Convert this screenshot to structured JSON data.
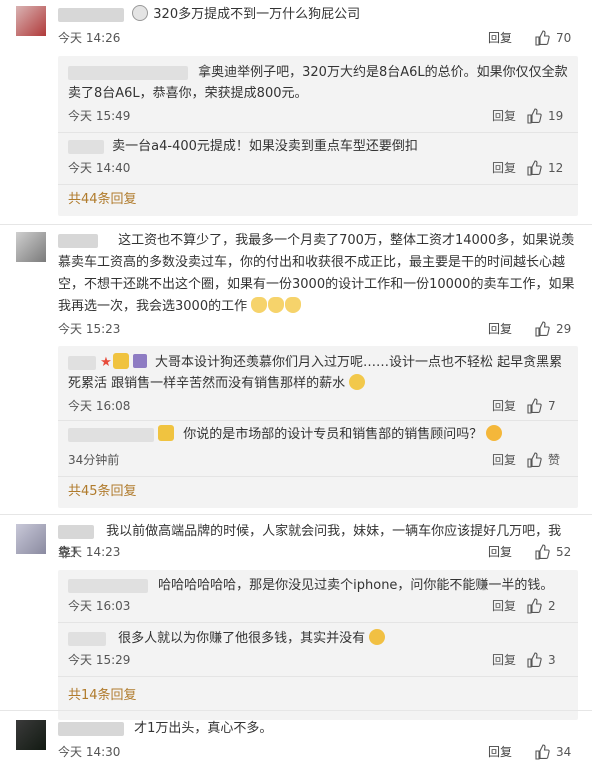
{
  "comments": [
    {
      "text": "320多万提成不到一万什么狗屁公司",
      "time": "今天 14:26",
      "reply_label": "回复",
      "likes": "70",
      "replies": [
        {
          "text": "拿奥迪举例子吧，320万大约是8台A6L的总价。如果你仅仅全款卖了8台A6L，恭喜你，荣获提成800元。",
          "time": "今天 15:49",
          "reply_label": "回复",
          "likes": "19"
        },
        {
          "text": "卖一台a4-400元提成！如果没卖到重点车型还要倒扣",
          "time": "今天 14:40",
          "reply_label": "回复",
          "likes": "12"
        }
      ],
      "more": "共44条回复"
    },
    {
      "text": "这工资也不算少了，我最多一个月卖了700万，整体工资才14000多，如果说羡慕卖车工资高的多数没卖过车，你的付出和收获很不成正比，最主要是干的时间越长心越空，不想干还跳不出这个圈，如果有一份3000的设计工作和一份10000的卖车工作，如果我再选一次，我会选3000的工作",
      "time": "今天 15:23",
      "reply_label": "回复",
      "likes": "29",
      "replies": [
        {
          "text": "大哥本设计狗还羡慕你们月入过万呢……设计一点也不轻松 起早贪黑累死累活 跟销售一样辛苦然而没有销售那样的薪水",
          "time": "今天 16:08",
          "reply_label": "回复",
          "likes": "7"
        },
        {
          "text": "你说的是市场部的设计专员和销售部的销售顾问吗？",
          "time": "34分钟前",
          "reply_label": "回复",
          "likes": "赞"
        }
      ],
      "more": "共45条回复"
    },
    {
      "text": "我以前做高端品牌的时候，人家就会问我，妹妹，一辆车你应该提好几万吧，我靠！",
      "time": "今天 14:23",
      "reply_label": "回复",
      "likes": "52",
      "replies": [
        {
          "text": "哈哈哈哈哈哈，那是你没见过卖个iphone，问你能不能赚一半的钱。",
          "time": "今天 16:03",
          "reply_label": "回复",
          "likes": "2"
        },
        {
          "text": "很多人就以为你赚了他很多钱，其实并没有",
          "time": "今天 15:29",
          "reply_label": "回复",
          "likes": "3"
        }
      ],
      "more": "共14条回复"
    },
    {
      "text": "才1万出头，真心不多。",
      "time": "今天 14:30",
      "reply_label": "回复",
      "likes": "34"
    }
  ]
}
